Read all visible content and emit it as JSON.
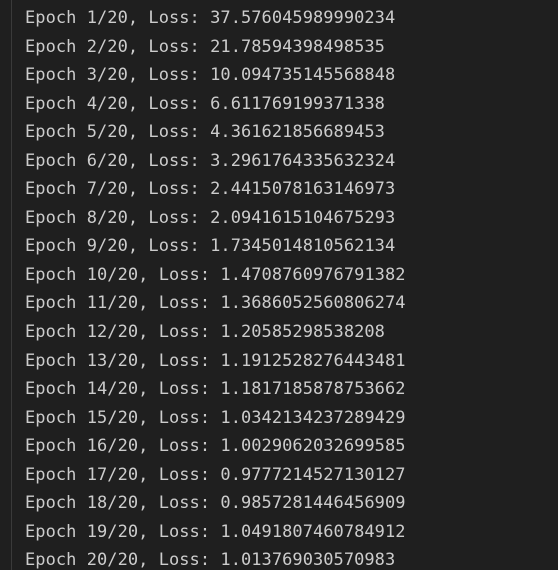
{
  "terminal": {
    "lines": [
      "Epoch 1/20, Loss: 37.576045989990234",
      "Epoch 2/20, Loss: 21.78594398498535",
      "Epoch 3/20, Loss: 10.094735145568848",
      "Epoch 4/20, Loss: 6.611769199371338",
      "Epoch 5/20, Loss: 4.361621856689453",
      "Epoch 6/20, Loss: 3.2961764335632324",
      "Epoch 7/20, Loss: 2.4415078163146973",
      "Epoch 8/20, Loss: 2.0941615104675293",
      "Epoch 9/20, Loss: 1.7345014810562134",
      "Epoch 10/20, Loss: 1.4708760976791382",
      "Epoch 11/20, Loss: 1.3686052560806274",
      "Epoch 12/20, Loss: 1.20585298538208",
      "Epoch 13/20, Loss: 1.1912528276443481",
      "Epoch 14/20, Loss: 1.1817185878753662",
      "Epoch 15/20, Loss: 1.0342134237289429",
      "Epoch 16/20, Loss: 1.0029062032699585",
      "Epoch 17/20, Loss: 0.9777214527130127",
      "Epoch 18/20, Loss: 0.9857281446456909",
      "Epoch 19/20, Loss: 1.0491807460784912",
      "Epoch 20/20, Loss: 1.013769030570983"
    ]
  },
  "colors": {
    "background": "#1f1f1f",
    "text": "#cccccc",
    "border": "#3a3a3a"
  }
}
